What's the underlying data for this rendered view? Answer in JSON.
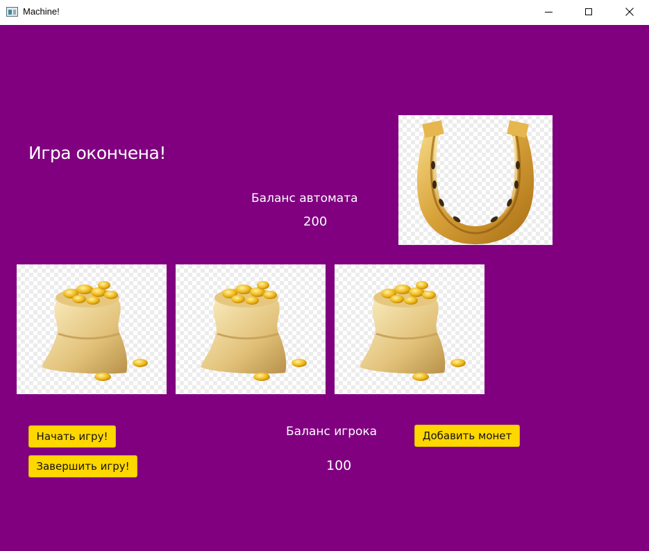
{
  "window": {
    "title": "Machine!",
    "controls": {
      "minimize": "minimize-icon",
      "maximize": "maximize-icon",
      "close": "close-icon"
    }
  },
  "colors": {
    "background": "#800080",
    "button": "#ffd700",
    "text": "#ffffff"
  },
  "status": {
    "message": "Игра окончена!"
  },
  "machine": {
    "balance_label": "Баланс автомата",
    "balance_value": "200"
  },
  "player": {
    "balance_label": "Баланс игрока",
    "balance_value": "100"
  },
  "images": {
    "lucky_symbol": "horseshoe-image",
    "reels": [
      "money-bag-image",
      "money-bag-image",
      "money-bag-image"
    ]
  },
  "buttons": {
    "start": "Начать игру!",
    "end": "Завершить игру!",
    "add_coins": "Добавить монет"
  }
}
